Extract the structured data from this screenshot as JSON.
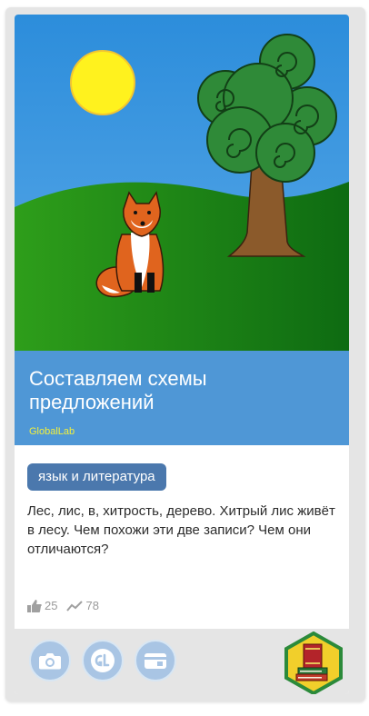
{
  "card": {
    "title": "Составляем схемы предложений",
    "author": "GlobalLab",
    "tag": "язык и литература",
    "description": "Лес, лис, в, хитрость, дерево. Хитрый лис живёт в лесу. Чем похожи эти две записи? Чем они отличаются?",
    "likes": "25",
    "views": "78"
  },
  "footer": {
    "icons": [
      "camera-icon",
      "globallab-icon",
      "card-icon",
      "books-badge-icon"
    ]
  },
  "colors": {
    "title_bg": "#4f97d6",
    "author": "#f2ef3b",
    "tag_bg": "#4b78ad",
    "footer_btn": "#a9c5e4",
    "badge_hex": "#f1cf2b"
  }
}
